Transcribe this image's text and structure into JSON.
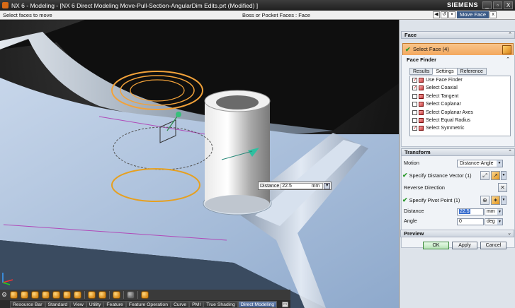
{
  "window": {
    "title": "NX 6 - Modeling - [NX 6 Direct Modeling Move-Pull-Section-AngularDim Edits.prt (Modified) ]",
    "brand": "SIEMENS",
    "buttons": [
      "_",
      "▫",
      "X"
    ]
  },
  "status_bar": {
    "prompt": "Select faces to move",
    "status": "Boss or Pocket Faces : Face",
    "dialog_name": "Move Face"
  },
  "viewport": {
    "distance_tooltip": {
      "label": "Distance",
      "value": "22.5",
      "unit": "mm"
    }
  },
  "toolbar": {
    "tabs": [
      "Resource Bar",
      "Standard",
      "View",
      "Utility",
      "Feature",
      "Feature Operation",
      "Curve",
      "PMI",
      "True Shading",
      "Direct Modeling"
    ],
    "active_tab": "Direct Modeling"
  },
  "dialog": {
    "face_group": {
      "title": "Face",
      "select_face": "Select Face (4)"
    },
    "face_finder": {
      "title": "Face Finder",
      "tabs": [
        "Results",
        "Settings",
        "Reference"
      ],
      "active_tab": "Settings",
      "items": [
        {
          "label": "Use Face Finder",
          "checked": true
        },
        {
          "label": "Select Coaxial",
          "checked": true
        },
        {
          "label": "Select Tangent",
          "checked": false
        },
        {
          "label": "Select Coplanar",
          "checked": false
        },
        {
          "label": "Select Coplanar Axes",
          "checked": false
        },
        {
          "label": "Select Equal Radius",
          "checked": false
        },
        {
          "label": "Select Symmetric",
          "checked": true
        }
      ]
    },
    "transform": {
      "title": "Transform",
      "motion_label": "Motion",
      "motion_value": "Distance-Angle",
      "specify_distance_vector": "Specify Distance Vector (1)",
      "reverse_direction": "Reverse Direction",
      "specify_pivot_point": "Specify Pivot Point (1)",
      "distance_label": "Distance",
      "distance_value": "22.5",
      "distance_unit": "mm",
      "angle_label": "Angle",
      "angle_value": "0",
      "angle_unit": "deg"
    },
    "preview": {
      "title": "Preview"
    },
    "buttons": {
      "ok": "OK",
      "apply": "Apply",
      "cancel": "Cancel"
    }
  },
  "colors": {
    "accent_orange": "#f3a75e",
    "dialog_bg": "#dde3ea",
    "title_bar": "#2a2a2a",
    "active_tab": "#3f5a8c",
    "model_face": "#a6bedc"
  }
}
